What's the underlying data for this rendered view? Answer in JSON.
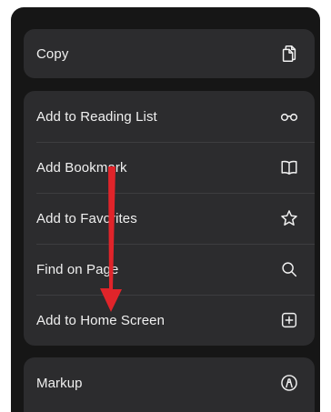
{
  "share_menu": {
    "copy": {
      "label": "Copy",
      "icon": "copy-icon"
    },
    "actions": [
      {
        "label": "Add to Reading List",
        "icon": "glasses-icon"
      },
      {
        "label": "Add Bookmark",
        "icon": "book-icon"
      },
      {
        "label": "Add to Favorites",
        "icon": "star-icon"
      },
      {
        "label": "Find on Page",
        "icon": "search-icon"
      },
      {
        "label": "Add to Home Screen",
        "icon": "add-square-icon"
      }
    ],
    "markup": {
      "label": "Markup",
      "icon": "markup-pen-icon"
    }
  },
  "annotation": {
    "arrow_color": "#e0242a",
    "arrow_icon": "red-arrow-down-icon"
  },
  "colors": {
    "sheet_background": "#161616",
    "group_background": "#2c2c2e",
    "text": "#f0f0f0"
  }
}
